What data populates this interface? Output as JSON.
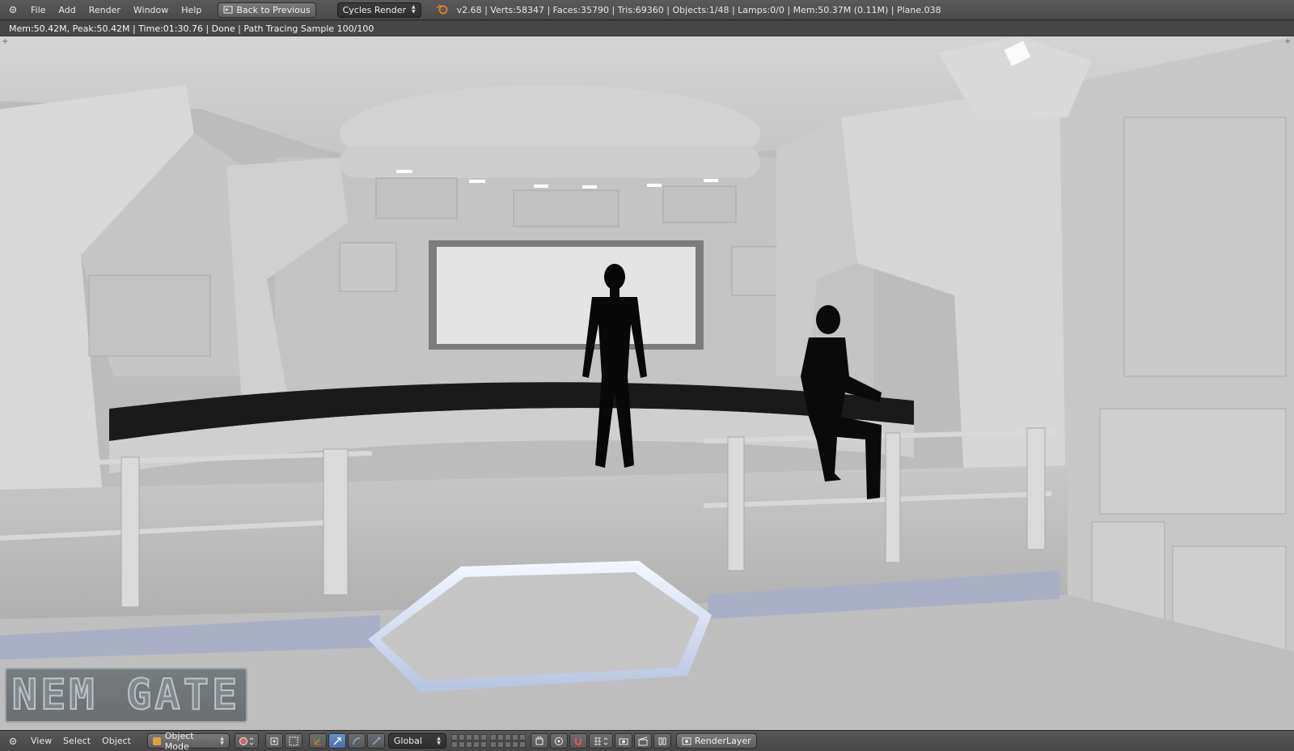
{
  "topbar": {
    "menus": [
      "File",
      "Add",
      "Render",
      "Window",
      "Help"
    ],
    "back_button": "Back to Previous",
    "render_engine": "Cycles Render",
    "stats": "v2.68 | Verts:58347 | Faces:35790 | Tris:69360 | Objects:1/48 | Lamps:0/0 | Mem:50.37M (0.11M) | Plane.038"
  },
  "render_info": "Mem:50.42M, Peak:50.42M | Time:01:30.76 | Done | Path Tracing Sample 100/100",
  "viewport": {
    "logo_text": "NEM GATE"
  },
  "bottombar": {
    "menus": [
      "View",
      "Select",
      "Object"
    ],
    "mode": "Object Mode",
    "orientation": "Global",
    "render_layer": "RenderLayer"
  },
  "colors": {
    "header_bg": "#4a4a4a",
    "viewport_bg": "#bcbcbc",
    "active_blue": "#4a6fa5",
    "object_orange": "#e1a03c"
  }
}
